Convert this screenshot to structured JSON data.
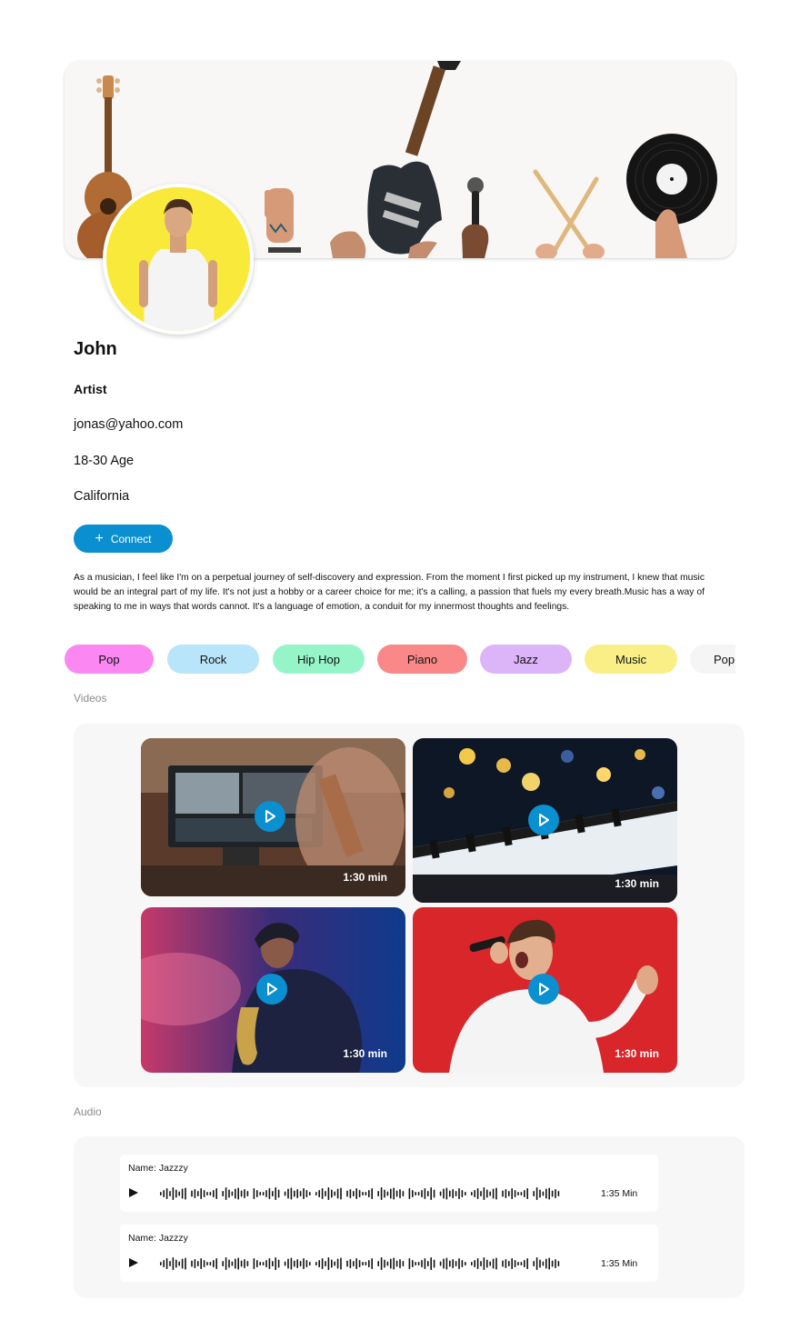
{
  "profile": {
    "name": "John",
    "role": "Artist",
    "email": "jonas@yahoo.com",
    "age": "18-30 Age",
    "location": "California",
    "connect_label": "Connect",
    "bio": "As a musician, I feel like I'm on a perpetual journey of self-discovery and expression. From the moment I first picked up my instrument, I knew that music would be an integral part of my life. It's not just a hobby or a career choice for me; it's a calling, a passion that fuels my every breath.Music has a way of speaking to me in ways that words cannot. It's a language of emotion, a conduit for my innermost thoughts and feelings."
  },
  "tags": [
    {
      "label": "Pop",
      "color": "#fa87f2"
    },
    {
      "label": "Rock",
      "color": "#b9e5fa"
    },
    {
      "label": "Hip Hop",
      "color": "#95f5c9"
    },
    {
      "label": "Piano",
      "color": "#fa8888"
    },
    {
      "label": "Jazz",
      "color": "#dcb4f8"
    },
    {
      "label": "Music",
      "color": "#f9ef86"
    },
    {
      "label": "Pop",
      "color": "#f5f5f5"
    }
  ],
  "videos": {
    "section_label": "Videos",
    "items": [
      {
        "title": "video-editing",
        "duration": "1:30 min"
      },
      {
        "title": "piano",
        "duration": "1:30 min"
      },
      {
        "title": "saxophone",
        "duration": "1:30 min"
      },
      {
        "title": "singer",
        "duration": "1:30 min"
      }
    ]
  },
  "audio": {
    "section_label": "Audio",
    "items": [
      {
        "name": "Name: Jazzzy",
        "duration": "1:35 Min"
      },
      {
        "name": "Name: Jazzzy",
        "duration": "1:35 Min"
      }
    ]
  },
  "colors": {
    "accent": "#0a8fd0",
    "panel_bg": "#f7f7f7",
    "avatar_bg": "#f9e93a"
  }
}
